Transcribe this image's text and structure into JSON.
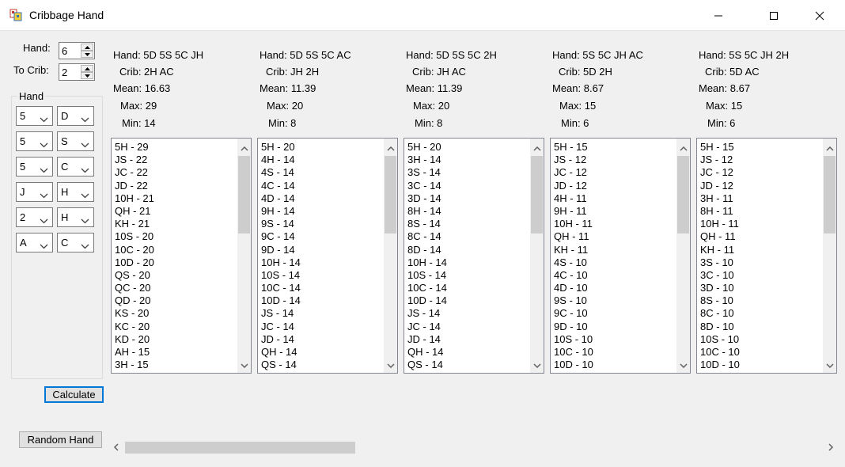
{
  "window": {
    "title": "Cribbage Hand"
  },
  "controls": {
    "hand_label": "Hand:",
    "hand_value": "6",
    "crib_label": "To Crib:",
    "crib_value": "2",
    "group_label": "Hand",
    "cards": [
      {
        "rank": "5",
        "suit": "D"
      },
      {
        "rank": "5",
        "suit": "S"
      },
      {
        "rank": "5",
        "suit": "C"
      },
      {
        "rank": "J",
        "suit": "H"
      },
      {
        "rank": "2",
        "suit": "H"
      },
      {
        "rank": "A",
        "suit": "C"
      }
    ],
    "calculate_label": "Calculate",
    "random_label": "Random Hand"
  },
  "results": [
    {
      "hand": "Hand: 5D 5S 5C JH",
      "crib": "Crib: 2H AC",
      "mean": "Mean: 16.63",
      "max": "Max: 29",
      "min": "Min: 14",
      "items": [
        "5H - 29",
        "JS - 22",
        "JC - 22",
        "JD - 22",
        "10H - 21",
        "QH - 21",
        "KH - 21",
        "10S - 20",
        "10C - 20",
        "10D - 20",
        "QS - 20",
        "QC - 20",
        "QD - 20",
        "KS - 20",
        "KC - 20",
        "KD - 20",
        "AH - 15",
        "3H - 15"
      ]
    },
    {
      "hand": "Hand: 5D 5S 5C AC",
      "crib": "Crib: JH 2H",
      "mean": "Mean: 11.39",
      "max": "Max: 20",
      "min": "Min: 8",
      "items": [
        "5H - 20",
        "4H - 14",
        "4S - 14",
        "4C - 14",
        "4D - 14",
        "9H - 14",
        "9S - 14",
        "9C - 14",
        "9D - 14",
        "10H - 14",
        "10S - 14",
        "10C - 14",
        "10D - 14",
        "JS - 14",
        "JC - 14",
        "JD - 14",
        "QH - 14",
        "QS - 14"
      ]
    },
    {
      "hand": "Hand: 5D 5S 5C 2H",
      "crib": "Crib: JH AC",
      "mean": "Mean: 11.39",
      "max": "Max: 20",
      "min": "Min: 8",
      "items": [
        "5H - 20",
        "3H - 14",
        "3S - 14",
        "3C - 14",
        "3D - 14",
        "8H - 14",
        "8S - 14",
        "8C - 14",
        "8D - 14",
        "10H - 14",
        "10S - 14",
        "10C - 14",
        "10D - 14",
        "JS - 14",
        "JC - 14",
        "JD - 14",
        "QH - 14",
        "QS - 14"
      ]
    },
    {
      "hand": "Hand: 5S 5C JH AC",
      "crib": "Crib: 5D 2H",
      "mean": "Mean: 8.67",
      "max": "Max: 15",
      "min": "Min: 6",
      "items": [
        "5H - 15",
        "JS - 12",
        "JC - 12",
        "JD - 12",
        "4H - 11",
        "9H - 11",
        "10H - 11",
        "QH - 11",
        "KH - 11",
        "4S - 10",
        "4C - 10",
        "4D - 10",
        "9S - 10",
        "9C - 10",
        "9D - 10",
        "10S - 10",
        "10C - 10",
        "10D - 10"
      ]
    },
    {
      "hand": "Hand: 5S 5C JH 2H",
      "crib": "Crib: 5D AC",
      "mean": "Mean: 8.67",
      "max": "Max: 15",
      "min": "Min: 6",
      "items": [
        "5H - 15",
        "JS - 12",
        "JC - 12",
        "JD - 12",
        "3H - 11",
        "8H - 11",
        "10H - 11",
        "QH - 11",
        "KH - 11",
        "3S - 10",
        "3C - 10",
        "3D - 10",
        "8S - 10",
        "8C - 10",
        "8D - 10",
        "10S - 10",
        "10C - 10",
        "10D - 10"
      ]
    }
  ],
  "icons": {
    "app": "cards-app-icon",
    "minimize": "minimize-icon",
    "maximize": "maximize-icon",
    "close": "close-icon"
  }
}
